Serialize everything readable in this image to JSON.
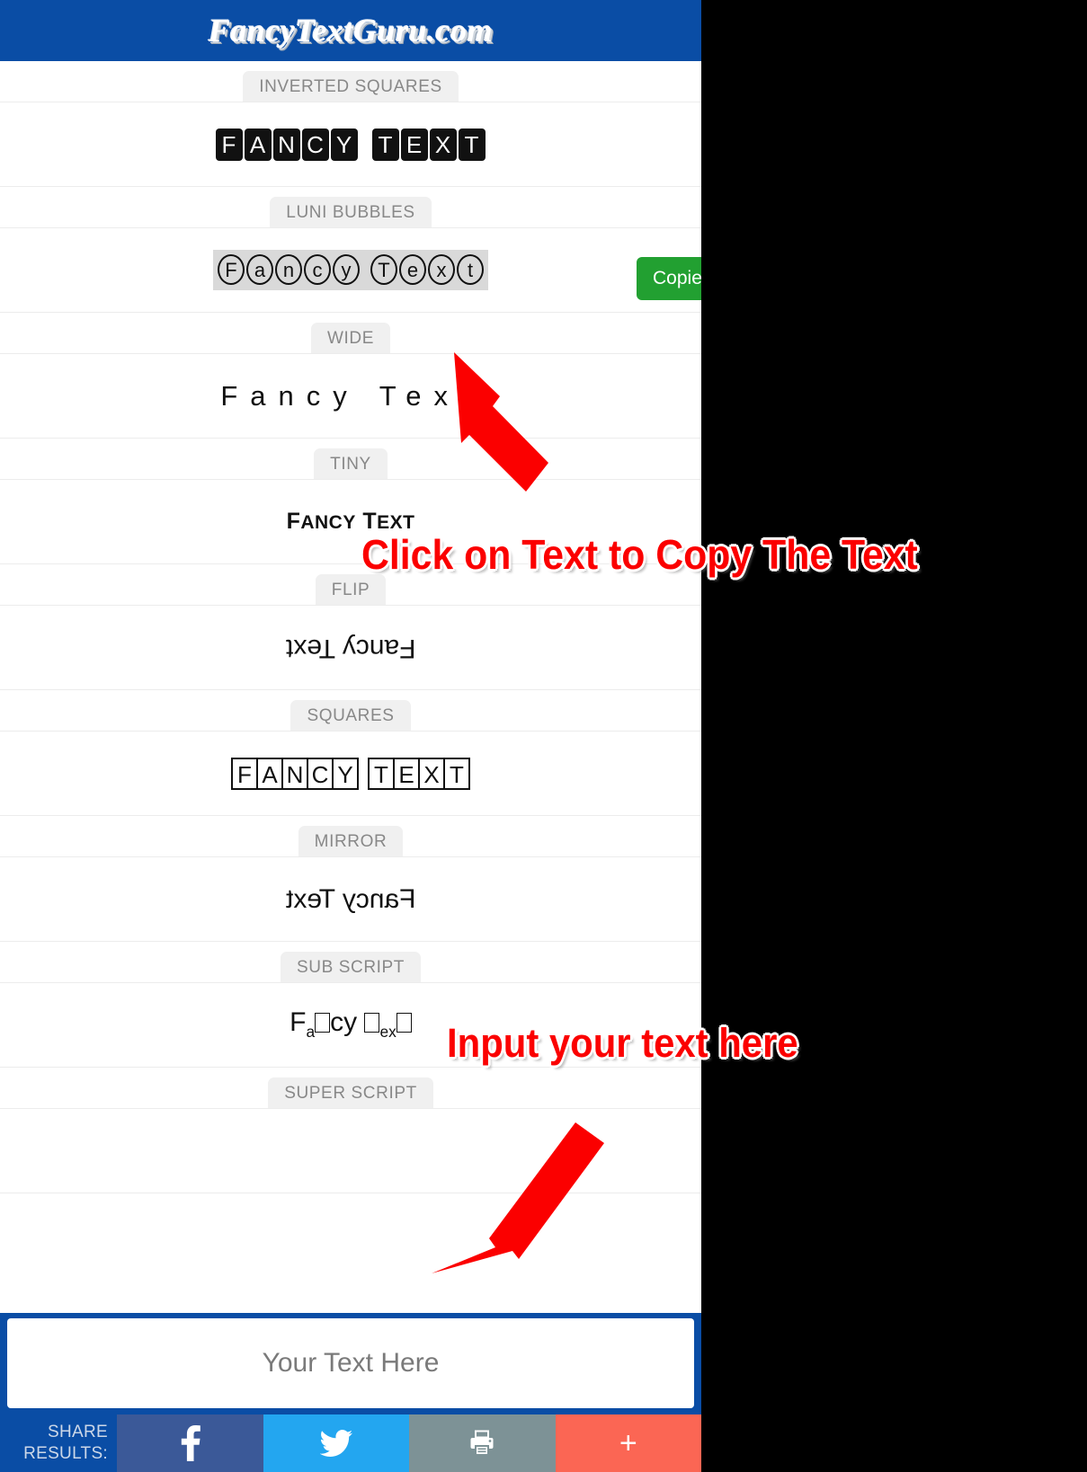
{
  "site": {
    "title": "FancyTextGuru.com",
    "header_bg": "#0a4da5"
  },
  "toast": {
    "label": "Copied",
    "bg": "#22a031"
  },
  "styles": [
    {
      "label": "INVERTED SQUARES",
      "sample": "🅵🅰🅽🅲🆈 🆃🅴🆇🆃",
      "plain": "FANCY TEXT",
      "kind": "inverted-squares"
    },
    {
      "label": "LUNI BUBBLES",
      "sample": "Ⓕⓐⓝⓒⓨ Ⓣⓔⓧⓣ",
      "plain": "Fancy Text",
      "kind": "luni-bubbles",
      "selected": true
    },
    {
      "label": "WIDE",
      "sample": "Fancy Text",
      "plain": "Fancy Text",
      "kind": "wide"
    },
    {
      "label": "TINY",
      "sample": "Fᴀɴᴄʏ Tᴇxᴛ",
      "plain": "FANCY TEXT",
      "kind": "tiny"
    },
    {
      "label": "FLIP",
      "sample": "ʇxǝ⊥ ʎɔuɐℲ",
      "plain": "Fancy Text",
      "kind": "flip"
    },
    {
      "label": "SQUARES",
      "sample": "🄵🄰🄽🄲🅈 🅃🄴🅇🅃",
      "plain": "FANCY TEXT",
      "kind": "squares"
    },
    {
      "label": "MIRROR",
      "sample": "ƚxɘT ʏɔnɒꟻ",
      "plain": "Fancy Text",
      "kind": "mirror"
    },
    {
      "label": "SUB SCRIPT",
      "sample": "Fₐ□cy □ₑₓ□",
      "plain": "Fancy Text",
      "kind": "sub-script"
    },
    {
      "label": "SUPER SCRIPT",
      "sample": "",
      "plain": "Fancy Text",
      "kind": "super-script"
    }
  ],
  "input": {
    "placeholder": "Your Text Here",
    "value": ""
  },
  "share": {
    "label_line1": "SHARE",
    "label_line2": "RESULTS:",
    "buttons": [
      {
        "name": "facebook",
        "icon": "facebook-icon",
        "color": "#3b5998",
        "glyph": "f"
      },
      {
        "name": "twitter",
        "icon": "twitter-icon",
        "color": "#23a6f0",
        "glyph": ""
      },
      {
        "name": "print",
        "icon": "printer-icon",
        "color": "#7d9296",
        "glyph": ""
      },
      {
        "name": "more",
        "icon": "plus-icon",
        "color": "#fb6654",
        "glyph": "+"
      }
    ]
  },
  "annotations": {
    "click_text": "Click on Text to Copy The Text",
    "input_text": "Input your text here",
    "color": "#fb0000"
  }
}
